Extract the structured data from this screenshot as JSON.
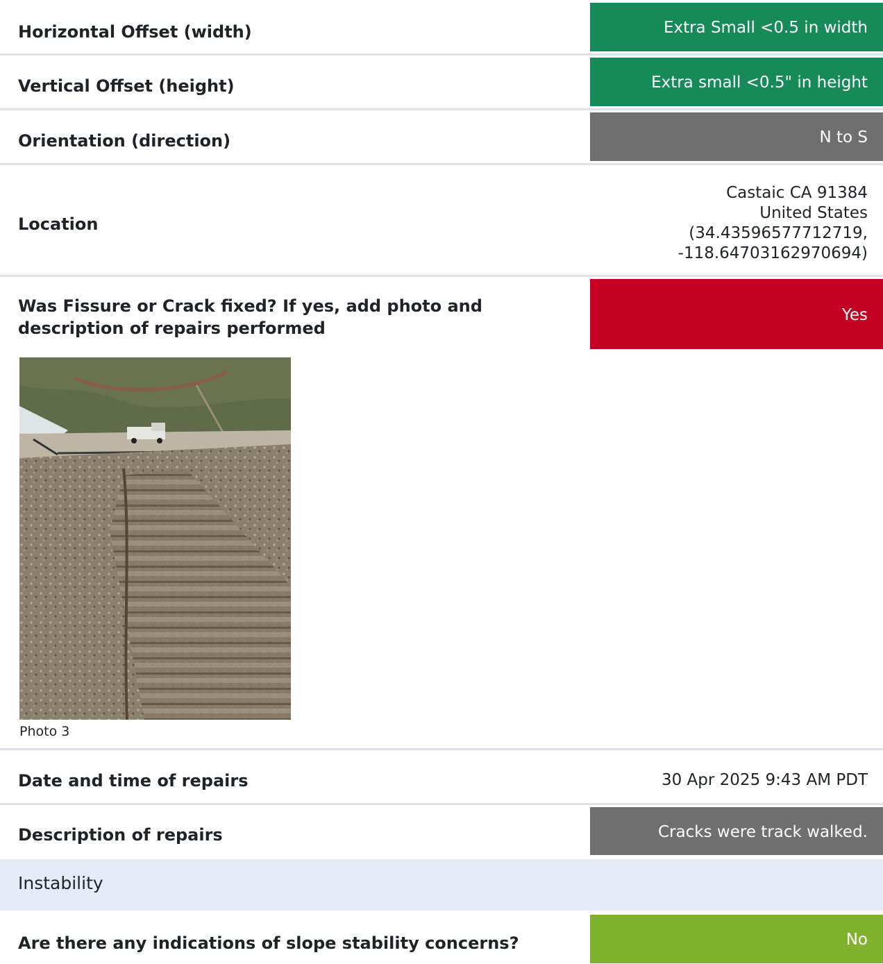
{
  "rows": [
    {
      "label": "Horizontal Offset (width)",
      "value": "Extra Small <0.5 in width",
      "color": "#178a5a"
    },
    {
      "label": "Vertical Offset (height)",
      "value": "Extra small <0.5\" in height",
      "color": "#178a5a"
    },
    {
      "label": "Orientation (direction)",
      "value": "N to S",
      "color": "#6f6f6f"
    }
  ],
  "location": {
    "label": "Location",
    "lines": [
      "Castaic CA 91384",
      "United States",
      "(34.43596577712719,",
      "-118.64703162970694)"
    ]
  },
  "fixed": {
    "label": "Was Fissure or Crack fixed? If yes, add photo and description of repairs performed",
    "value": "Yes",
    "color": "#c40023",
    "photo_caption": "Photo 3"
  },
  "repair_date": {
    "label": "Date and time of repairs",
    "value": "30 Apr 2025 9:43 AM PDT"
  },
  "repair_desc": {
    "label": "Description of repairs",
    "value": "Cracks were track walked.",
    "color": "#6f6f6f"
  },
  "section": {
    "title": "Instability"
  },
  "slope": {
    "label": "Are there any indications of slope stability concerns?",
    "value": "No",
    "color": "#80b22e"
  }
}
